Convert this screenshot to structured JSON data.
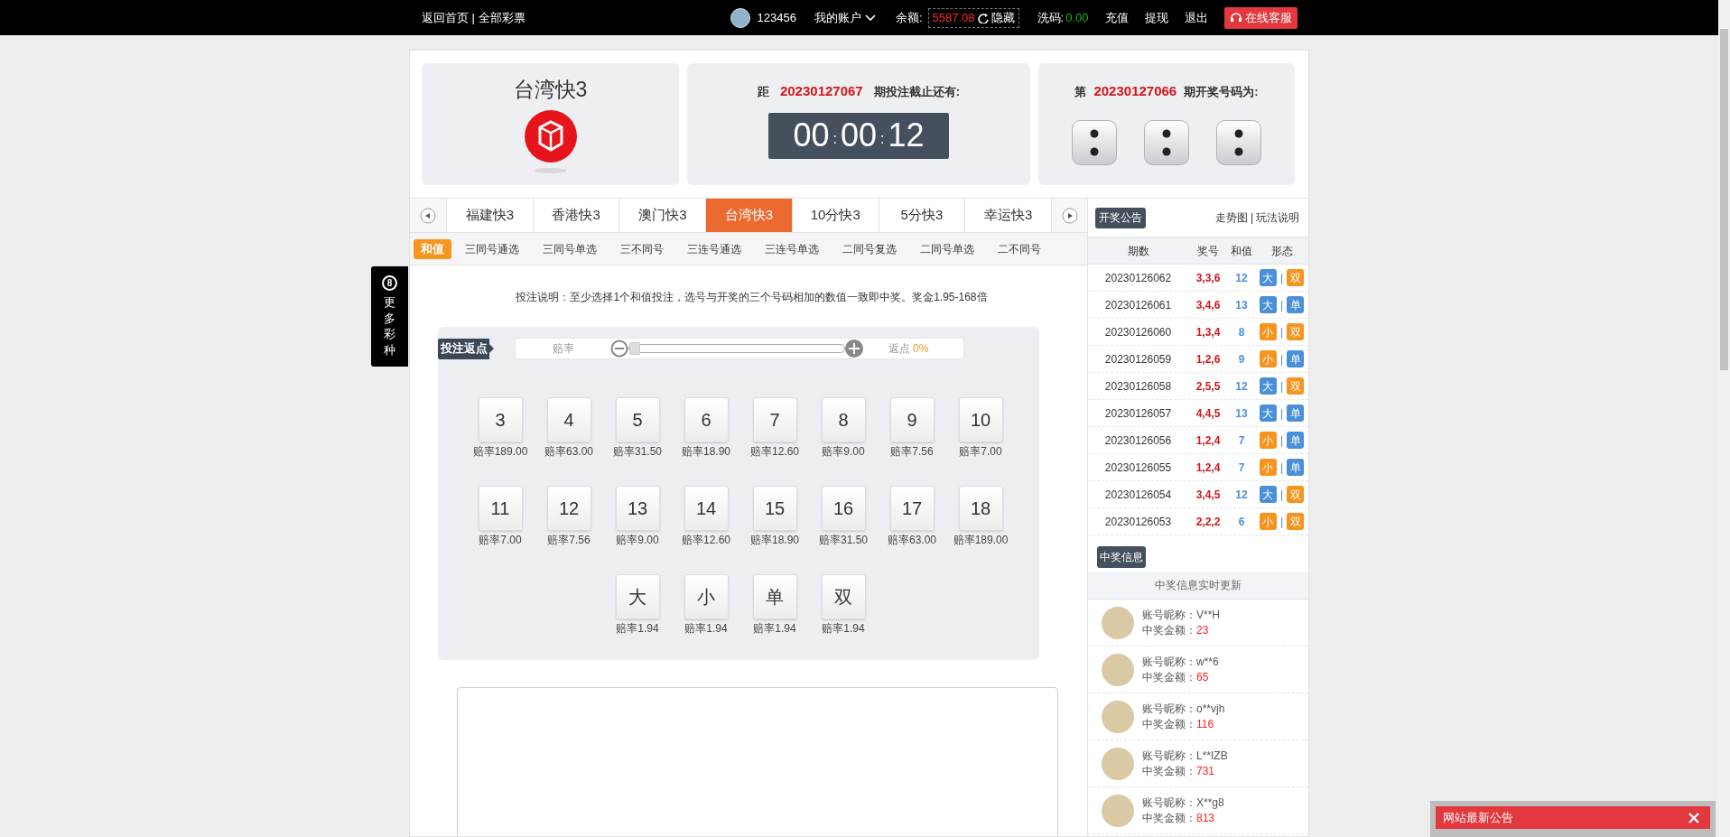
{
  "top_bar": {
    "links": [
      {
        "label": "返回首页"
      },
      {
        "label": "全部彩票"
      }
    ],
    "link_separator": "|",
    "user": {
      "name": "123456"
    },
    "account_menu": "我的账户",
    "balance_label": "余额:",
    "balance": "5587.08",
    "hide": "隐藏",
    "wash_label": "洗码:",
    "wash": "0.00",
    "actions": [
      "充值",
      "提现",
      "退出"
    ],
    "service": "在线客服"
  },
  "side_menu": {
    "badge": "8",
    "label": "更多彩种"
  },
  "game": {
    "title": "台湾快3"
  },
  "countdown": {
    "prefix": "距",
    "issue": "20230127067",
    "suffix": "期投注截止还有:",
    "parts": [
      "00",
      "00",
      "12"
    ],
    "separator": ":"
  },
  "last_result": {
    "prefix": "第",
    "issue": "20230127066",
    "suffix": "期开奖号码为:",
    "dice": [
      {
        "kind": "two"
      },
      {
        "kind": "two"
      },
      {
        "kind": "two"
      }
    ]
  },
  "game_tabs": [
    {
      "label": "福建快3",
      "selected": false
    },
    {
      "label": "香港快3",
      "selected": false
    },
    {
      "label": "澳门快3",
      "selected": false
    },
    {
      "label": "台湾快3",
      "selected": true
    },
    {
      "label": "10分快3",
      "selected": false
    },
    {
      "label": "5分快3",
      "selected": false
    },
    {
      "label": "幸运快3",
      "selected": false
    }
  ],
  "play_tabs": [
    {
      "label": "和值",
      "selected": true
    },
    {
      "label": "三同号通选",
      "selected": false
    },
    {
      "label": "三同号单选",
      "selected": false
    },
    {
      "label": "三不同号",
      "selected": false
    },
    {
      "label": "三连号通选",
      "selected": false
    },
    {
      "label": "三连号单选",
      "selected": false
    },
    {
      "label": "二同号复选",
      "selected": false
    },
    {
      "label": "二同号单选",
      "selected": false
    },
    {
      "label": "二不同号",
      "selected": false
    }
  ],
  "instruction": "投注说明：至少选择1个和值投注，选号与开奖的三个号码相加的数值一致即中奖。奖金1.95-168倍",
  "rebate": {
    "label": "投注返点",
    "odds_label": "赔率",
    "level": 0,
    "rebate_label": "返点",
    "rebate_value": "0%"
  },
  "bet_rows": [
    [
      {
        "label": "3",
        "odds": "赔率189.00"
      },
      {
        "label": "4",
        "odds": "赔率63.00"
      },
      {
        "label": "5",
        "odds": "赔率31.50"
      },
      {
        "label": "6",
        "odds": "赔率18.90"
      },
      {
        "label": "7",
        "odds": "赔率12.60"
      },
      {
        "label": "8",
        "odds": "赔率9.00"
      },
      {
        "label": "9",
        "odds": "赔率7.56"
      },
      {
        "label": "10",
        "odds": "赔率7.00"
      }
    ],
    [
      {
        "label": "11",
        "odds": "赔率7.00"
      },
      {
        "label": "12",
        "odds": "赔率7.56"
      },
      {
        "label": "13",
        "odds": "赔率9.00"
      },
      {
        "label": "14",
        "odds": "赔率12.60"
      },
      {
        "label": "15",
        "odds": "赔率18.90"
      },
      {
        "label": "16",
        "odds": "赔率31.50"
      },
      {
        "label": "17",
        "odds": "赔率63.00"
      },
      {
        "label": "18",
        "odds": "赔率189.00"
      }
    ],
    [
      {
        "label": "大",
        "odds": "赔率1.94"
      },
      {
        "label": "小",
        "odds": "赔率1.94"
      },
      {
        "label": "单",
        "odds": "赔率1.94"
      },
      {
        "label": "双",
        "odds": "赔率1.94"
      }
    ]
  ],
  "results_panel": {
    "title": "开奖公告",
    "links": [
      "走势图",
      "玩法说明"
    ],
    "link_separator": "|",
    "columns": [
      "期数",
      "奖号",
      "和值",
      "形态"
    ],
    "rows": [
      {
        "issue": "20230126062",
        "numbers": "3,3,6",
        "sum": "12",
        "size": {
          "label": "大",
          "color": "#4a90d9"
        },
        "parity": {
          "label": "双",
          "color": "#f7941d"
        }
      },
      {
        "issue": "20230126061",
        "numbers": "3,4,6",
        "sum": "13",
        "size": {
          "label": "大",
          "color": "#4a90d9"
        },
        "parity": {
          "label": "单",
          "color": "#4a90d9"
        }
      },
      {
        "issue": "20230126060",
        "numbers": "1,3,4",
        "sum": "8",
        "size": {
          "label": "小",
          "color": "#f7941d"
        },
        "parity": {
          "label": "双",
          "color": "#f7941d"
        }
      },
      {
        "issue": "20230126059",
        "numbers": "1,2,6",
        "sum": "9",
        "size": {
          "label": "小",
          "color": "#f7941d"
        },
        "parity": {
          "label": "单",
          "color": "#4a90d9"
        }
      },
      {
        "issue": "20230126058",
        "numbers": "2,5,5",
        "sum": "12",
        "size": {
          "label": "大",
          "color": "#4a90d9"
        },
        "parity": {
          "label": "双",
          "color": "#f7941d"
        }
      },
      {
        "issue": "20230126057",
        "numbers": "4,4,5",
        "sum": "13",
        "size": {
          "label": "大",
          "color": "#4a90d9"
        },
        "parity": {
          "label": "单",
          "color": "#4a90d9"
        }
      },
      {
        "issue": "20230126056",
        "numbers": "1,2,4",
        "sum": "7",
        "size": {
          "label": "小",
          "color": "#f7941d"
        },
        "parity": {
          "label": "单",
          "color": "#4a90d9"
        }
      },
      {
        "issue": "20230126055",
        "numbers": "1,2,4",
        "sum": "7",
        "size": {
          "label": "小",
          "color": "#f7941d"
        },
        "parity": {
          "label": "单",
          "color": "#4a90d9"
        }
      },
      {
        "issue": "20230126054",
        "numbers": "3,4,5",
        "sum": "12",
        "size": {
          "label": "大",
          "color": "#4a90d9"
        },
        "parity": {
          "label": "双",
          "color": "#f7941d"
        }
      },
      {
        "issue": "20230126053",
        "numbers": "2,2,2",
        "sum": "6",
        "size": {
          "label": "小",
          "color": "#f7941d"
        },
        "parity": {
          "label": "双",
          "color": "#f7941d"
        }
      }
    ],
    "tag_separator": "|"
  },
  "winners": {
    "title": "中奖信息",
    "subtitle": "中奖信息实时更新",
    "entries": [
      {
        "name_label": "账号昵称：",
        "name": "V**H",
        "amount_label": "中奖金额：",
        "amount": "23"
      },
      {
        "name_label": "账号昵称：",
        "name": "w**6",
        "amount_label": "中奖金额：",
        "amount": "65"
      },
      {
        "name_label": "账号昵称：",
        "name": "o**vjh",
        "amount_label": "中奖金额：",
        "amount": "116"
      },
      {
        "name_label": "账号昵称：",
        "name": "L**IZB",
        "amount_label": "中奖金额：",
        "amount": "731"
      },
      {
        "name_label": "账号昵称：",
        "name": "X**g8",
        "amount_label": "中奖金额：",
        "amount": "813"
      }
    ]
  },
  "notice": {
    "title": "网站最新公告"
  }
}
